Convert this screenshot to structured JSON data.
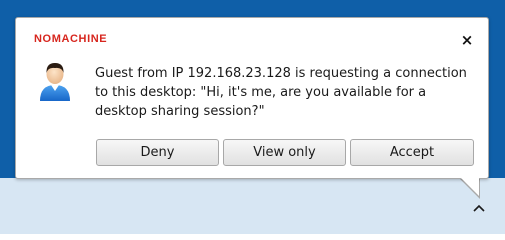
{
  "colors": {
    "desktop_background": "#0f5fa8",
    "taskbar": "#d7e6f3",
    "brand": "#d7261e"
  },
  "notification": {
    "brand": "NOMACHINE",
    "close_glyph": "×",
    "avatar_icon": "user-avatar-icon",
    "message_lines": [
      "Guest from IP 192.168.23.128 is requesting a connection",
      "to this desktop: \"Hi, it's me, are you available for a",
      "desktop sharing session?\""
    ],
    "buttons": {
      "deny": "Deny",
      "view_only": "View only",
      "accept": "Accept"
    }
  },
  "taskbar": {
    "tray_icon": "chevron-up-icon"
  }
}
